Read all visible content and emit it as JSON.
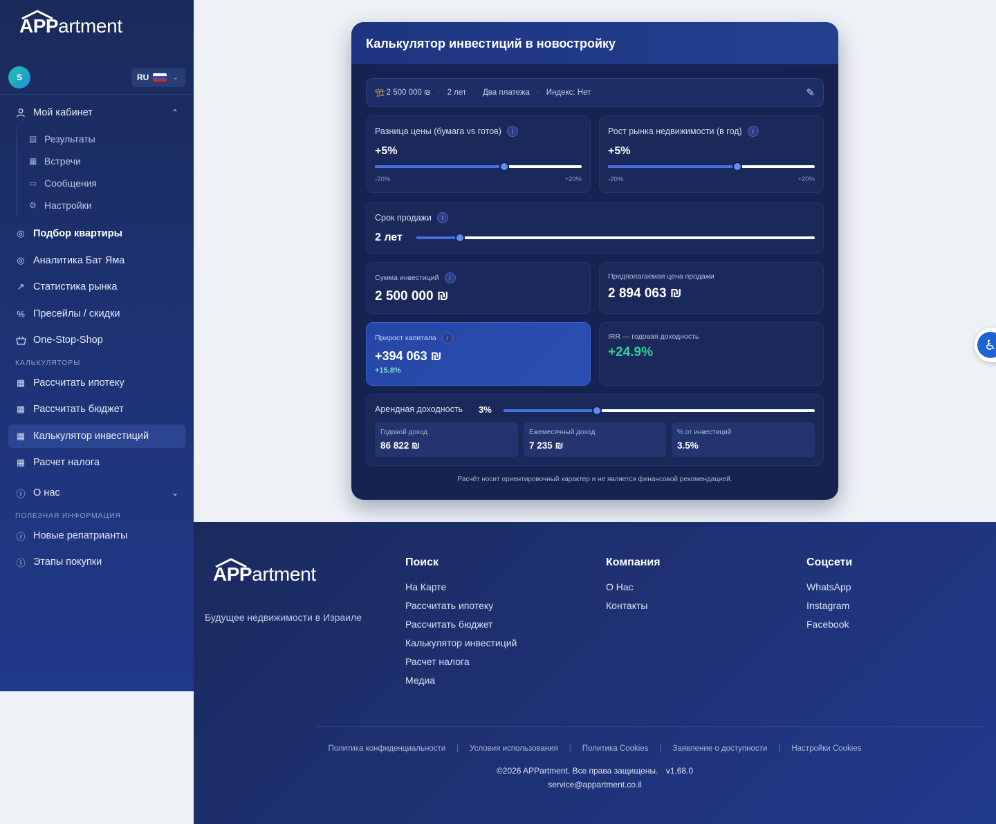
{
  "brand": {
    "logo_app": "APP",
    "logo_rest": "artment",
    "tagline": "Будущее недвижимости в Израиле"
  },
  "user": {
    "avatar_letter": "S"
  },
  "language": {
    "code": "RU"
  },
  "sidebar": {
    "my_cabinet": "Мой кабинет",
    "sub_items": [
      "Результаты",
      "Встречи",
      "Сообщения",
      "Настройки"
    ],
    "main_items": [
      "Подбор квартиры",
      "Аналитика Бат Яма",
      "Статистика рынка",
      "Пресейлы / скидки",
      "One-Stop-Shop"
    ],
    "calculators_label": "КАЛЬКУЛЯТОРЫ",
    "calculators": [
      "Рассчитать ипотеку",
      "Рассчитать бюджет",
      "Калькулятор инвестиций",
      "Расчет налога"
    ],
    "about": "О нас",
    "useful_label": "ПОЛЕЗНАЯ ИНФОРМАЦИЯ",
    "useful": [
      "Новые репатрианты",
      "Этапы покупки"
    ]
  },
  "calculator": {
    "title": "Калькулятор инвестиций в новостройку",
    "summary": {
      "amount": "2 500 000 ₪",
      "term": "2 лет",
      "payments": "Два платежа",
      "index": "Индекс: Нет"
    },
    "price_diff": {
      "label": "Разница цены (бумага vs готов)",
      "value": "+5%",
      "min": "-20%",
      "max": "+20%",
      "level": 0.625
    },
    "market_growth": {
      "label": "Рост рынка недвижимости (в год)",
      "value": "+5%",
      "min": "-20%",
      "max": "+20%",
      "level": 0.625
    },
    "sale_term": {
      "label": "Срок продажи",
      "value": "2 лет",
      "level": 0.11
    },
    "investment_sum": {
      "label": "Сумма инвестиций",
      "value": "2 500 000 ₪"
    },
    "expected_price": {
      "label": "Предполагаемая цена продажи",
      "value": "2 894 063 ₪"
    },
    "capital_gain": {
      "label": "Прирост капитала",
      "value": "+394 063 ₪",
      "percent": "+15.8%"
    },
    "irr": {
      "label": "IRR — годовая доходность",
      "value": "+24.9%"
    },
    "rental": {
      "label": "Арендная доходность",
      "value": "3%",
      "level": 0.3,
      "annual_label": "Годовой доход",
      "annual_value": "86 822 ₪",
      "monthly_label": "Ежемесячный доход",
      "monthly_value": "7 235 ₪",
      "percent_label": "% от инвестиций",
      "percent_value": "3.5%"
    },
    "disclaimer": "Расчёт носит ориентировочный характер и не является финансовой рекомендацией."
  },
  "footer": {
    "search": {
      "title": "Поиск",
      "links": [
        "На Карте",
        "Рассчитать ипотеку",
        "Рассчитать бюджет",
        "Калькулятор инвестиций",
        "Расчет налога",
        "Медиа"
      ]
    },
    "company": {
      "title": "Компания",
      "links": [
        "О Нас",
        "Контакты"
      ]
    },
    "social": {
      "title": "Соцсети",
      "links": [
        "WhatsApp",
        "Instagram",
        "Facebook"
      ]
    },
    "legal": [
      "Политика конфиденциальности",
      "Условия использования",
      "Политика Cookies",
      "Заявление о доступности",
      "Настройки Cookies"
    ],
    "copyright": "©2026 APPartment. Все права защищены.",
    "version": "v1.68.0",
    "email": "service@appartment.co.il"
  },
  "colors": {
    "accent": "#4a6ee0",
    "positive": "#2ed29a",
    "sidebar": "#1e3377"
  }
}
